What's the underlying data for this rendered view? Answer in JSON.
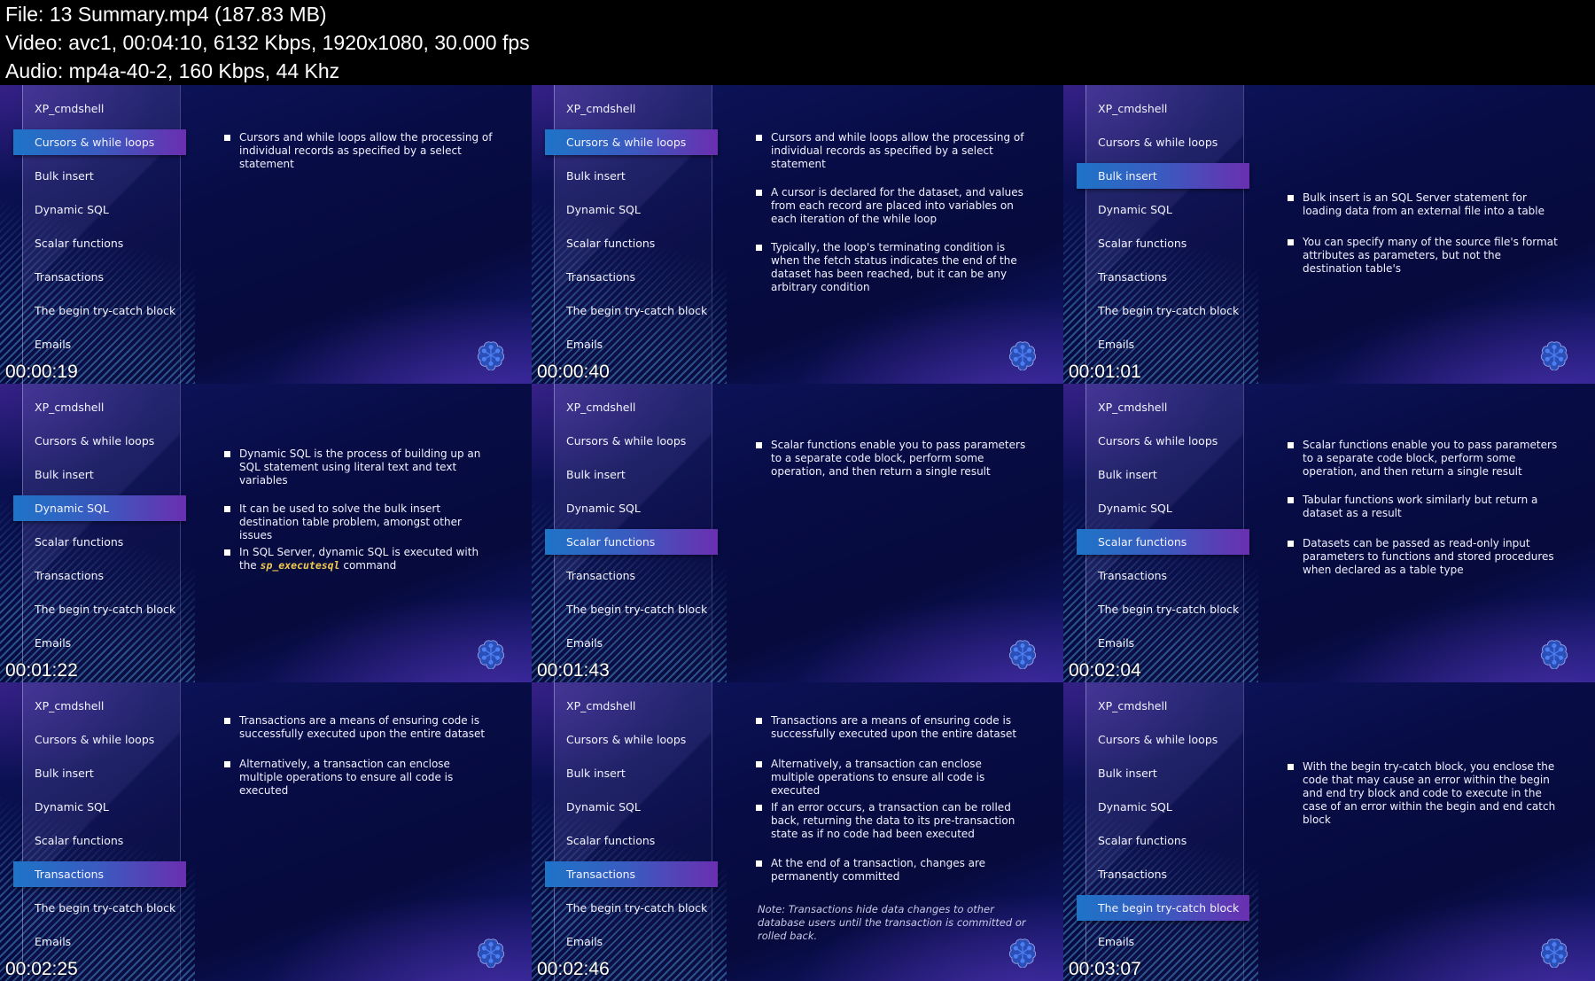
{
  "header": {
    "file_line": "File: 13  Summary.mp4 (187.83 MB)",
    "video_line": "Video: avc1, 00:04:10, 6132 Kbps, 1920x1080, 30.000 fps",
    "audio_line": "Audio: mp4a-40-2, 160 Kbps, 44 Khz"
  },
  "nav_items": [
    "XP_cmdshell",
    "Cursors & while loops",
    "Bulk insert",
    "Dynamic SQL",
    "Scalar functions",
    "Transactions",
    "The begin try-catch block",
    "Emails"
  ],
  "colors": {
    "highlight_start": "#1e74c8",
    "highlight_end": "#6a2fb0",
    "code_accent": "#f2c94c",
    "background": "#070c45"
  },
  "logo_icon": "flower-network-logo-icon",
  "tiles": [
    {
      "timestamp": "00:00:19",
      "active_index": 1,
      "bullets": [
        {
          "text": "Cursors and while loops allow the processing of individual records as specified by a select statement"
        }
      ],
      "note": ""
    },
    {
      "timestamp": "00:00:40",
      "active_index": 1,
      "bullets": [
        {
          "text": "Cursors and while loops allow the processing of individual records as specified by a select statement"
        },
        {
          "text": "A cursor is declared for the dataset, and values from each record are placed into variables on each iteration of the while loop"
        },
        {
          "text": "Typically, the loop's terminating condition is when the fetch status indicates the end of the dataset has been reached, but it can be any arbitrary condition"
        }
      ],
      "note": ""
    },
    {
      "timestamp": "00:01:01",
      "active_index": 2,
      "bullets": [
        {
          "text": "Bulk insert is an SQL Server statement for loading data from an external file into a table"
        },
        {
          "text": "You can specify many of the source file's format attributes as parameters, but not the destination table's"
        }
      ],
      "note": ""
    },
    {
      "timestamp": "00:01:22",
      "active_index": 3,
      "bullets": [
        {
          "text": "Dynamic SQL is the process of building up an SQL statement using literal text and text variables"
        },
        {
          "text": "It can be used to solve the bulk insert destination table problem, amongst other issues"
        },
        {
          "text": "In SQL Server, dynamic SQL is executed with the ",
          "code": "sp_executesql",
          "after": " command"
        }
      ],
      "note": ""
    },
    {
      "timestamp": "00:01:43",
      "active_index": 4,
      "bullets": [
        {
          "text": "Scalar functions enable you to pass parameters to a separate code block, perform some operation, and then return a single result"
        }
      ],
      "note": ""
    },
    {
      "timestamp": "00:02:04",
      "active_index": 4,
      "bullets": [
        {
          "text": "Scalar functions enable you to pass parameters to a separate code block, perform some operation, and then return a single result"
        },
        {
          "text": "Tabular functions work similarly but return a dataset as a result"
        },
        {
          "text": "Datasets can be passed as read-only input parameters to functions and stored procedures when declared as a table type"
        }
      ],
      "note": ""
    },
    {
      "timestamp": "00:02:25",
      "active_index": 5,
      "bullets": [
        {
          "text": "Transactions are a means of ensuring code is successfully executed upon the entire dataset"
        },
        {
          "text": "Alternatively, a transaction can enclose multiple operations to ensure all code is executed"
        }
      ],
      "note": ""
    },
    {
      "timestamp": "00:02:46",
      "active_index": 5,
      "bullets": [
        {
          "text": "Transactions are a means of ensuring code is successfully executed upon the entire dataset"
        },
        {
          "text": "Alternatively, a transaction can enclose multiple operations to ensure all code is executed"
        },
        {
          "text": "If an error occurs, a transaction can be rolled back, returning the data to its pre-transaction state as if no code had been executed"
        },
        {
          "text": "At the end of a transaction, changes are permanently committed"
        }
      ],
      "note": "Note: Transactions hide data changes to other database users until the transaction is committed or rolled back."
    },
    {
      "timestamp": "00:03:07",
      "active_index": 6,
      "bullets": [
        {
          "text": "With the begin try-catch block, you enclose the code that may cause an error within the begin and end try block and code to execute in the case of an error within the begin and end catch block"
        }
      ],
      "note": ""
    }
  ]
}
